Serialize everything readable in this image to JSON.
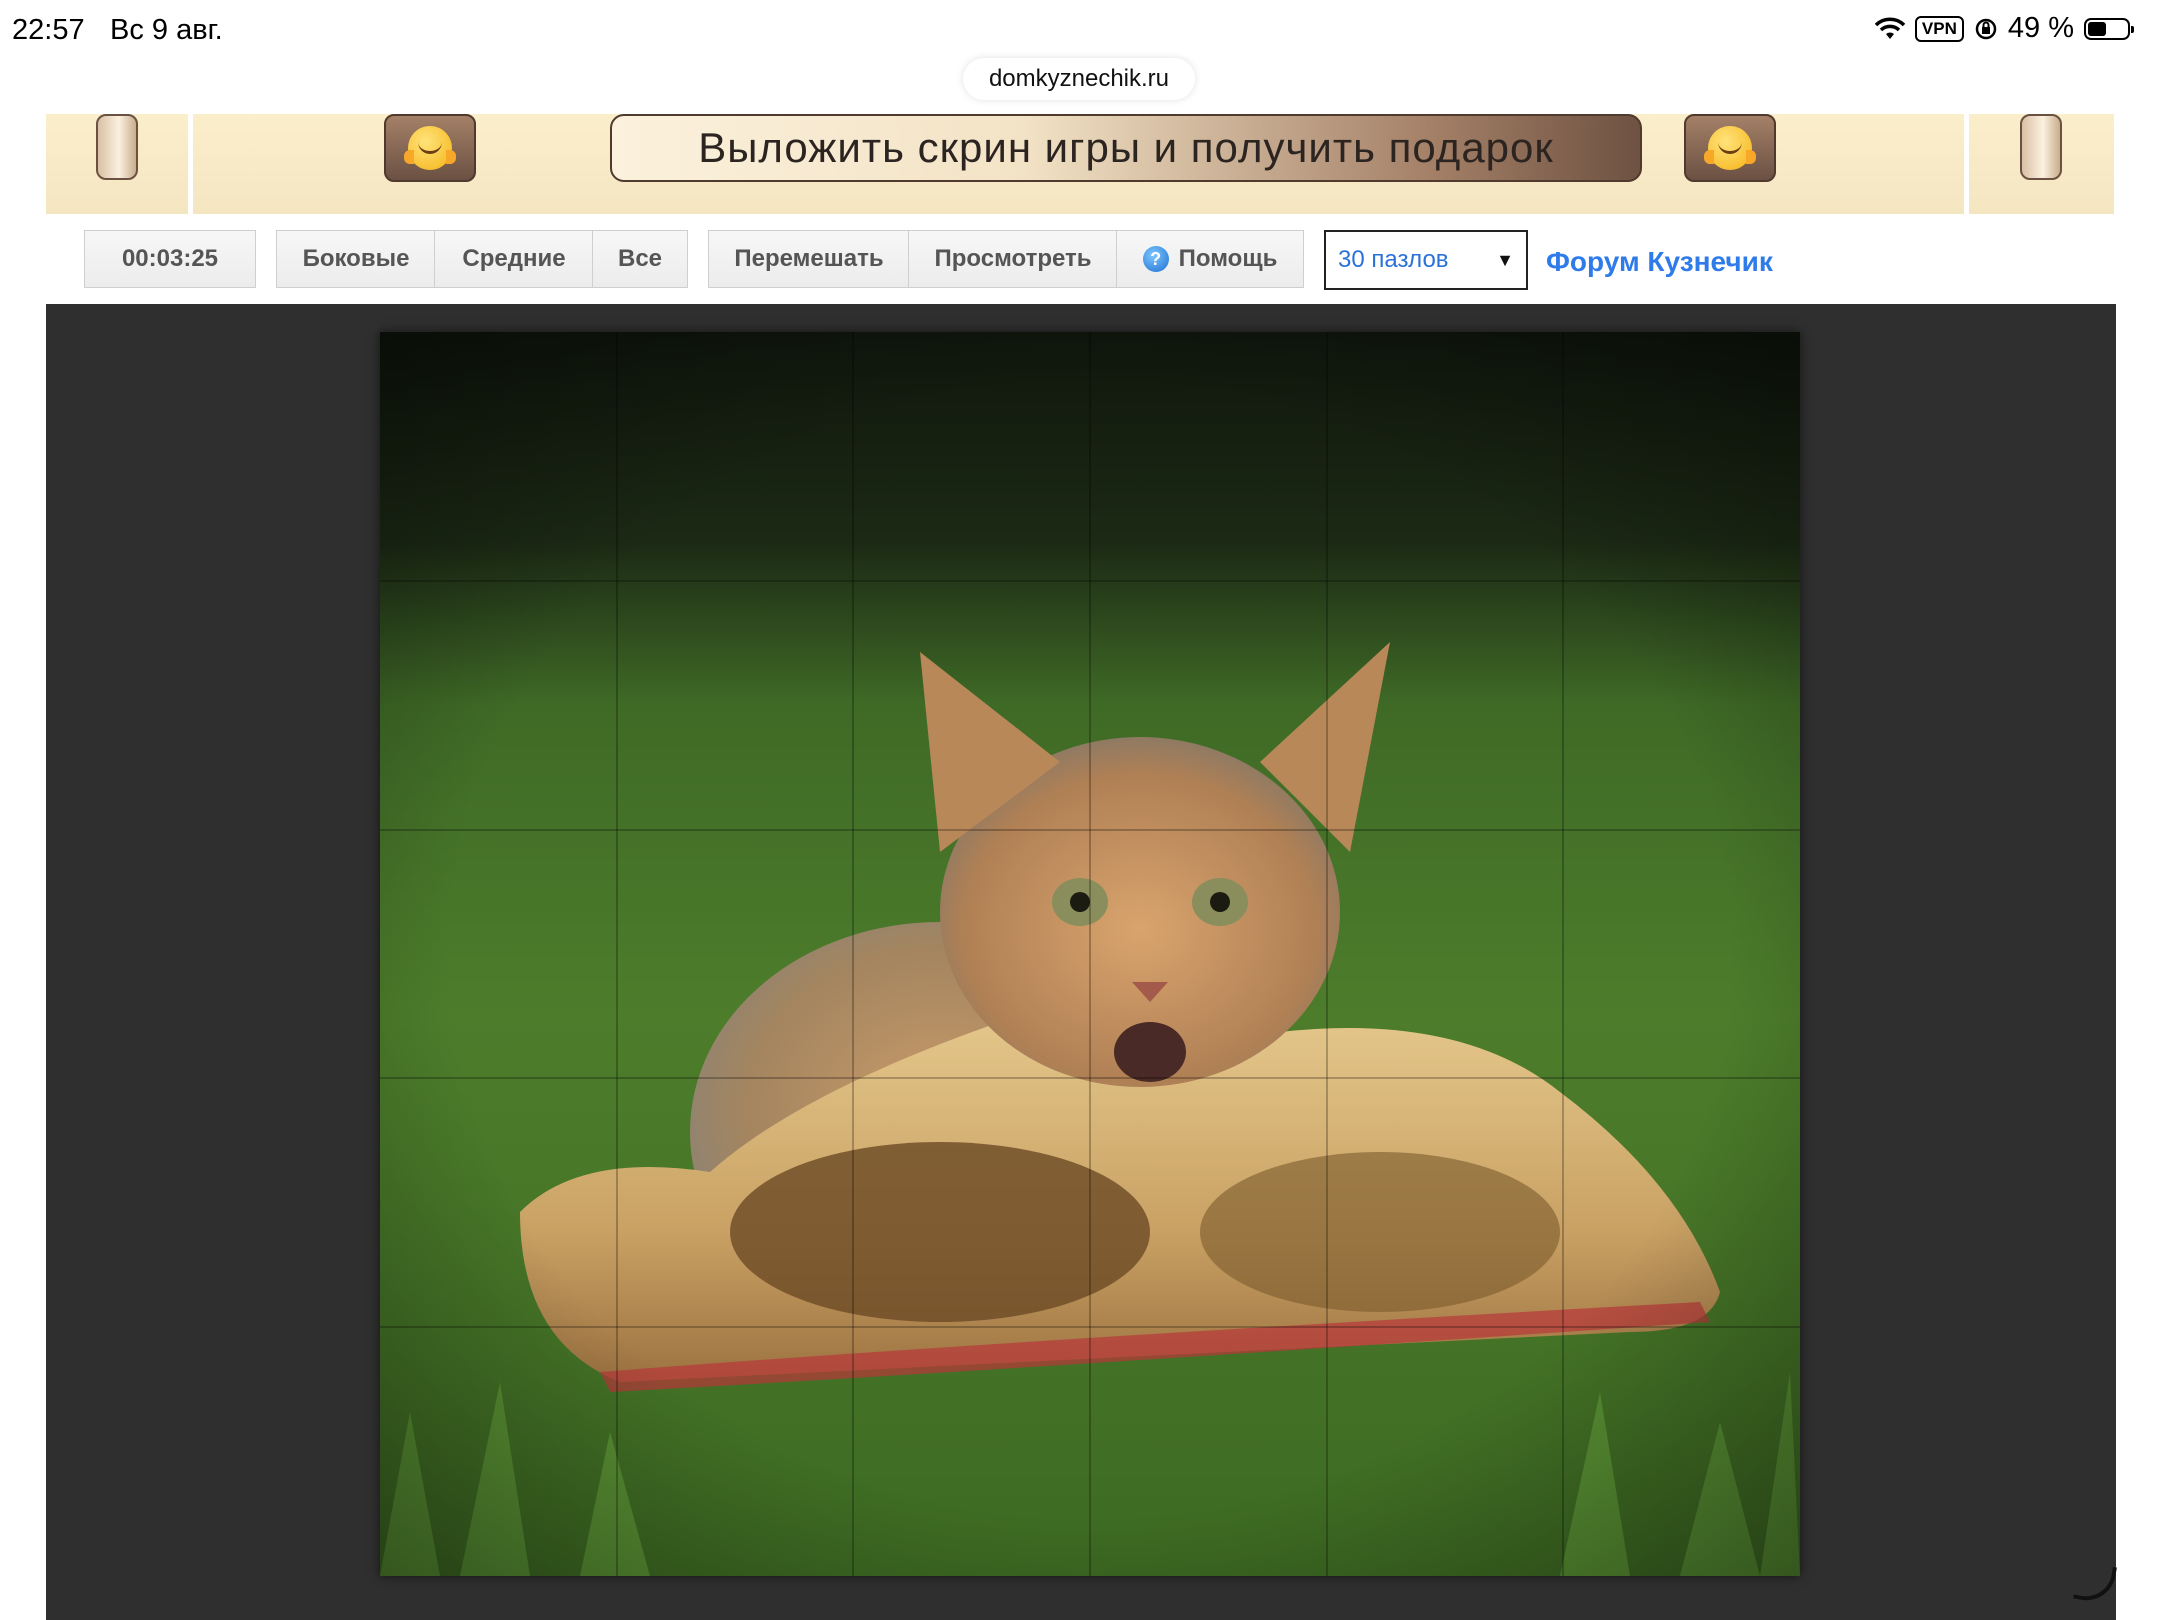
{
  "status_bar": {
    "time": "22:57",
    "date": "Вс 9 авг.",
    "vpn": "VPN",
    "battery": "49 %",
    "battery_level": 0.49
  },
  "browser": {
    "url": "domkyznechik.ru"
  },
  "banner": {
    "text": "Выложить скрин игры и получить подарок",
    "emoji_icon": "hugging-face-icon"
  },
  "toolbar": {
    "timer": "00:03:25",
    "filter_buttons": [
      "Боковые",
      "Средние",
      "Все"
    ],
    "action_buttons": [
      "Перемешать",
      "Просмотреть"
    ],
    "help_label": "Помощь",
    "pieces_select": "30 пазлов",
    "forum_link": "Форум Кузнечик"
  },
  "puzzle": {
    "columns": 6,
    "rows": 5,
    "image_subject": "kitten-on-shoe"
  },
  "colors": {
    "accent_link": "#2f7bea",
    "game_background": "#2f2f2f",
    "banner_background": "#fbeecb"
  }
}
